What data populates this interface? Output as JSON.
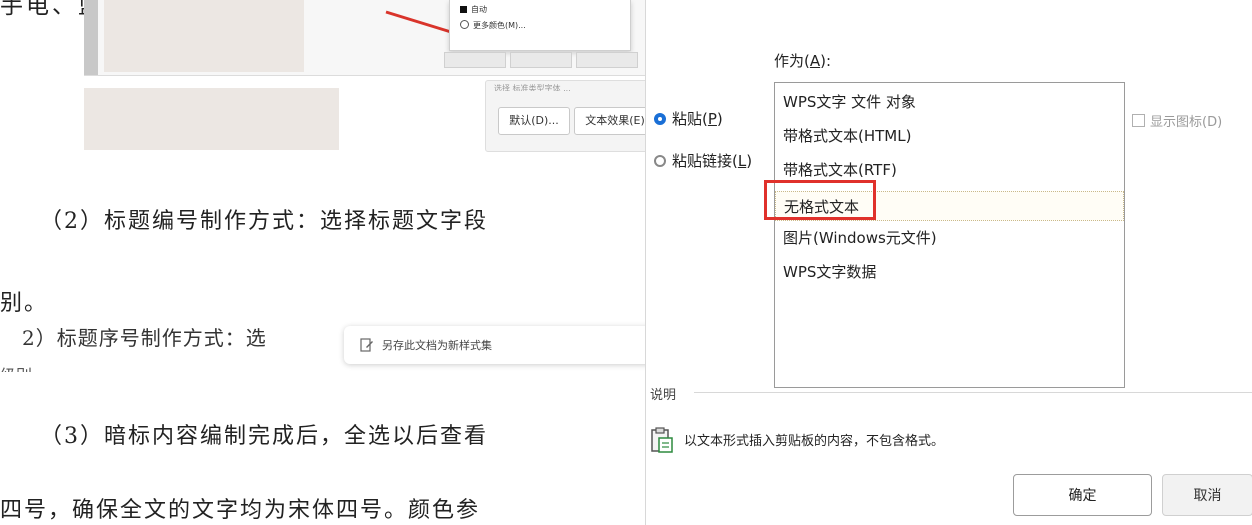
{
  "document": {
    "top_line": "手电、蓝色手表显示说，颜色为作图",
    "shot1": {
      "menu_items": [
        "自动",
        "更多颜色(M)..."
      ],
      "mini_buttons": [
        "",
        "",
        ""
      ]
    },
    "shot2": {
      "header": "选择 标准类型字体 ...",
      "buttons": [
        "默认(D)...",
        "文本效果(E)"
      ]
    },
    "para2_line1": "（2）标题编号制作方式：选择标题文字段",
    "para2_line2": "别。",
    "para2_small": "2）标题序号制作方式：选",
    "para2_cut": "级别",
    "toast_text": "另存此文档为新样式集",
    "para3_line1": "（3）暗标内容编制完成后，全选以后查看",
    "para3_line2": "四号，确保全文的文字均为宋体四号。颜色参"
  },
  "dialog": {
    "as_label": "作为",
    "as_shortcut": "A",
    "radios": [
      {
        "label": "粘贴",
        "shortcut": "P",
        "checked": true
      },
      {
        "label": "粘贴链接",
        "shortcut": "L",
        "checked": false
      }
    ],
    "list_items": [
      "WPS文字 文件 对象",
      "带格式文本(HTML)",
      "带格式文本(RTF)",
      "无格式文本",
      "图片(Windows元文件)",
      "WPS文字数据"
    ],
    "selected_index": 3,
    "show_icon_label": "显示图标(D)",
    "description_label": "说明",
    "description_text": "以文本形式插入剪贴板的内容，不包含格式。",
    "ok_label": "确定",
    "cancel_label": "取消"
  },
  "colors": {
    "accent": "#1a6fd6",
    "highlight_red": "#e0312b"
  },
  "icons": {
    "radio_selected": "radio-selected-icon",
    "clipboard": "clipboard-icon",
    "document_save": "save-style-icon"
  }
}
